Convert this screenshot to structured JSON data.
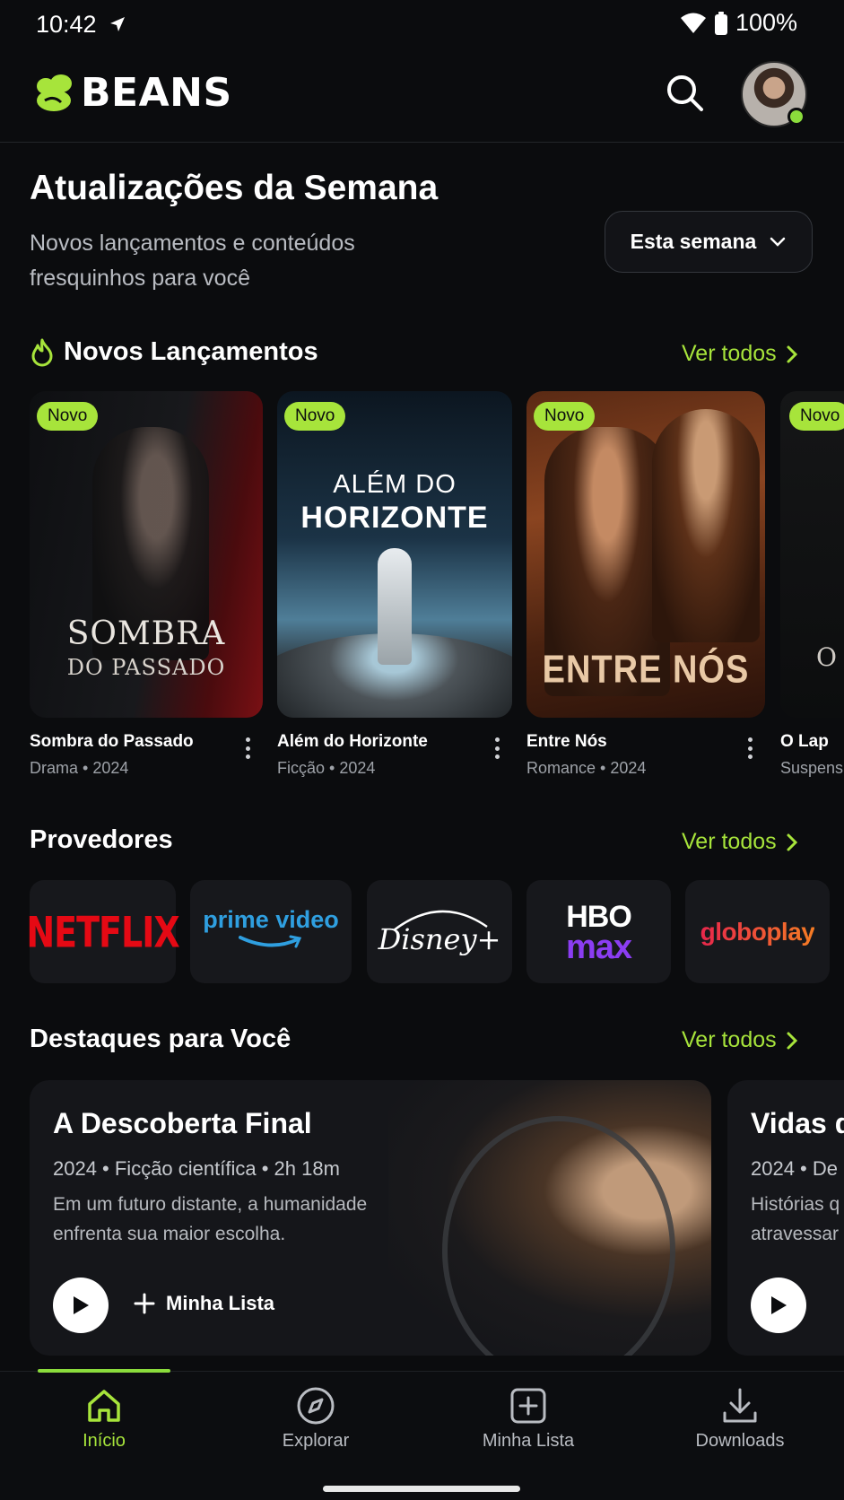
{
  "status": {
    "time": "10:42",
    "battery": "100%"
  },
  "header": {
    "brand": "BEANS"
  },
  "hero": {
    "title": "Atualizações da Semana",
    "subtitle": "Novos lançamentos e conteúdos fresquinhos para você",
    "filter_label": "Esta semana"
  },
  "releases": {
    "heading": "Novos Lançamentos",
    "see_all": "Ver todos",
    "badge": "Novo",
    "items": [
      {
        "title": "Sombra do Passado",
        "meta": "Drama • 2024",
        "poster_line1": "SOMBRA",
        "poster_line2": "DO PASSADO"
      },
      {
        "title": "Além do Horizonte",
        "meta": "Ficção • 2024",
        "poster_line1": "ALÉM DO",
        "poster_line2": "HORIZONTE"
      },
      {
        "title": "Entre Nós",
        "meta": "Romance • 2024",
        "poster_line1": "ENTRE NÓS"
      },
      {
        "title": "O Lap",
        "meta": "Suspens",
        "poster_line1": "O"
      }
    ]
  },
  "providers": {
    "heading": "Provedores",
    "see_all": "Ver todos",
    "items": [
      {
        "name": "NETFLIX",
        "color": "#e50914"
      },
      {
        "name": "prime video",
        "color": "#2f9fe0"
      },
      {
        "name": "Disney+",
        "color": "#ffffff"
      },
      {
        "name": "HBO",
        "sub": "max",
        "color": "#ffffff",
        "sub_color": "#8b3df2"
      },
      {
        "name": "globoplay",
        "color": "#f05a28"
      }
    ]
  },
  "featured": {
    "heading": "Destaques para Você",
    "see_all": "Ver todos",
    "items": [
      {
        "title": "A Descoberta Final",
        "meta": "2024 • Ficção científica • 2h 18m",
        "description": "Em um futuro distante, a humanidade enfrenta sua maior escolha.",
        "list_label": "Minha Lista"
      },
      {
        "title": "Vidas d",
        "meta": "2024 • De",
        "description": "Histórias q atravessar"
      }
    ]
  },
  "nav": {
    "items": [
      {
        "label": "Início",
        "icon": "home-icon",
        "active": true
      },
      {
        "label": "Explorar",
        "icon": "compass-icon"
      },
      {
        "label": "Minha Lista",
        "icon": "add-square-icon"
      },
      {
        "label": "Downloads",
        "icon": "download-icon"
      }
    ]
  },
  "colors": {
    "accent": "#a7e43b",
    "background": "#0b0c0e"
  }
}
